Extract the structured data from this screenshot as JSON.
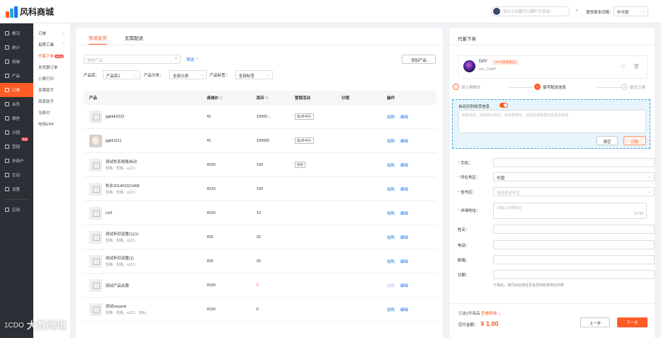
{
  "app": {
    "logo_text": "风科商城",
    "brand_color": "#ff5b26"
  },
  "header": {
    "search_placeholder": "有什么问题可以跟叮叮说说~",
    "close_glyph": "×",
    "language_label": "语言版本切换：",
    "language_value": "中文版"
  },
  "sidebar": {
    "items": [
      {
        "label": "概况",
        "icon": "dashboard-icon"
      },
      {
        "label": "统计",
        "icon": "chart-icon"
      },
      {
        "label": "商城",
        "icon": "store-icon"
      },
      {
        "label": "产品",
        "icon": "product-icon"
      },
      {
        "label": "订单",
        "icon": "order-icon"
      },
      {
        "label": "会员",
        "icon": "member-icon"
      },
      {
        "label": "微信",
        "icon": "wechat-icon"
      },
      {
        "label": "分销",
        "icon": "distribution-icon"
      },
      {
        "label": "营销",
        "icon": "marketing-icon",
        "badge": "hot"
      },
      {
        "label": "多商户",
        "icon": "multi-merchant-icon"
      },
      {
        "label": "互动",
        "icon": "interact-icon"
      },
      {
        "label": "设置",
        "icon": "settings-icon"
      },
      {
        "label": "应用",
        "icon": "apps-icon"
      }
    ]
  },
  "subnav": {
    "header": "订单",
    "group": "有赞工具",
    "items": [
      "代客下单",
      "发货跟订单",
      "小票打印",
      "发票助手",
      "商家助手",
      "当面付",
      "电商ERP"
    ],
    "new_badge": "NEW"
  },
  "main": {
    "tabs": [
      "快递发货",
      "无需配送"
    ],
    "search_placeholder": "搜索产品",
    "screen_label": "筛选",
    "add_button": "添加产品",
    "filters": [
      {
        "label": "产品库：",
        "value": "产品库1"
      },
      {
        "label": "产品分类：",
        "value": "全部分类"
      },
      {
        "label": "产品标签：",
        "value": "全部标签"
      }
    ],
    "columns": [
      "产品",
      "商城价",
      "库存",
      "营销活动",
      "分销",
      "操作"
    ],
    "rows": [
      {
        "name": "ggkkk2222",
        "spec": "",
        "price": "¥1",
        "stock": "10000...",
        "promo": "第2件半价",
        "thumb": "placeholder"
      },
      {
        "name": "ggkk1111",
        "spec": "",
        "price": "¥1",
        "stock": "100000",
        "promo": "第2件半价",
        "thumb": "dog"
      },
      {
        "name": "测试秒杀规格自动",
        "spec": "规格：规格，a121；",
        "price": "¥100",
        "stock": "100",
        "promo": "秒杀",
        "thumb": "placeholder"
      },
      {
        "name": "秒杀201401021458",
        "spec": "规格：规格，a121；",
        "price": "¥233",
        "stock": "100",
        "promo": "",
        "thumb": "placeholder"
      },
      {
        "name": "csl1",
        "spec": "",
        "price": "¥100",
        "stock": "10",
        "promo": "",
        "thumb": "placeholder"
      },
      {
        "name": "测试折扣设置(1)(1)",
        "spec": "规格：规格，a121；",
        "price": "¥20",
        "stock": "20",
        "promo": "",
        "thumb": "placeholder"
      },
      {
        "name": "测试折扣设置(1)",
        "spec": "规格：规格，a121；",
        "price": "¥20",
        "stock": "20",
        "promo": "",
        "thumb": "placeholder"
      },
      {
        "name": "测试产品关联",
        "spec": "",
        "price": "¥100",
        "stock": "0",
        "promo": "",
        "thumb": "placeholder",
        "stock_red": true,
        "buy_disabled": true
      },
      {
        "name": "测试expand",
        "spec": "规格：规格，a121，流色；",
        "price": "¥100",
        "stock": "6",
        "promo": "",
        "thumb": "placeholder"
      }
    ],
    "op_buy": "加购",
    "op_edit": "编辑"
  },
  "order_panel": {
    "title": "代客下单",
    "user": {
      "name": "DAY",
      "vip": "VIP1(普通会员)",
      "id": "wei_CrbpP"
    },
    "steps": [
      {
        "num": "✓",
        "label": "加入购物车",
        "state": "done"
      },
      {
        "num": "2",
        "label": "填写配送信息",
        "state": "active"
      },
      {
        "num": "3",
        "label": "提交订单",
        "state": "todo"
      }
    ],
    "paste": {
      "label": "自动识别收货信息",
      "placeholder": "粘贴信息，自动拆分姓名、电话和地址，识别后请检查信息是否有误",
      "clear": "清空",
      "identify": "识别"
    },
    "fields": {
      "phone": {
        "label": "手机：",
        "value": ""
      },
      "region": {
        "label": "所在地区：",
        "value": "中国"
      },
      "province": {
        "label": "省市区：",
        "value": "请选择省市区"
      },
      "address": {
        "label": "详细地址：",
        "value": "请输入详细地址",
        "count": "0 / 50"
      },
      "surname": {
        "label": "姓名：",
        "value": ""
      },
      "tel": {
        "label": "电话：",
        "value": ""
      },
      "postcode": {
        "label": "邮箱：",
        "value": ""
      },
      "date": {
        "label": "日期：",
        "value": ""
      }
    },
    "hint": "下单后，将同步此地址至会员的收货地址列表",
    "selected": "已选1件商品",
    "view_detail": "查看明细",
    "amount_label": "应付金额：",
    "amount": "¥ 1.00",
    "prev": "上一步",
    "next": "下一步"
  },
  "watermark": {
    "logo": "1CDO",
    "text": "大数跨境"
  }
}
